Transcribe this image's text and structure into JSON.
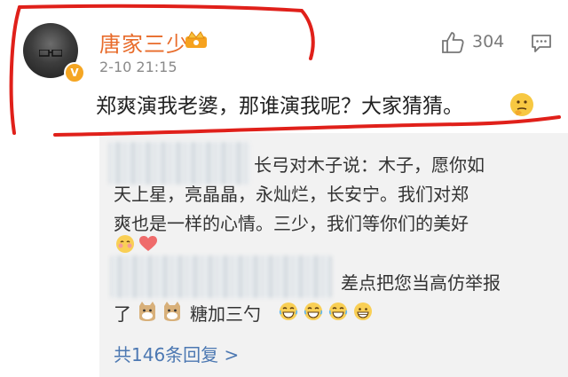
{
  "post": {
    "username": "唐家三少",
    "timestamp": "2-10 21:15",
    "like_count": "304",
    "text": "郑爽演我老婆，那谁演我呢？大家猜猜。"
  },
  "reply_1": {
    "author": "长弓对木子说：",
    "text_part1": "木子，愿你如",
    "line2": "天上星，亮晶晶，永灿烂，长安宁。我们对郑",
    "line3": "爽也是一样的心情。三少，我们等你们的美好"
  },
  "reply_2": {
    "text_line1": "差点把您当高仿举报",
    "text_line2_prefix": "了",
    "author": "糖加三勺"
  },
  "more_replies_label": "共146条回复 >",
  "icons": {
    "like": "thumbs-up-icon",
    "comment": "comment-icon",
    "crown": "crown-badge-icon",
    "verified": "verified-badge-icon",
    "thinking": "thinking-emoji",
    "laugh": "laughing-emoji",
    "cat": "cat-emoji"
  },
  "colors": {
    "username": "#e86b2a",
    "link": "#4c78b2",
    "annotation": "#e0201a",
    "reply_bg": "#f2f2f2"
  }
}
